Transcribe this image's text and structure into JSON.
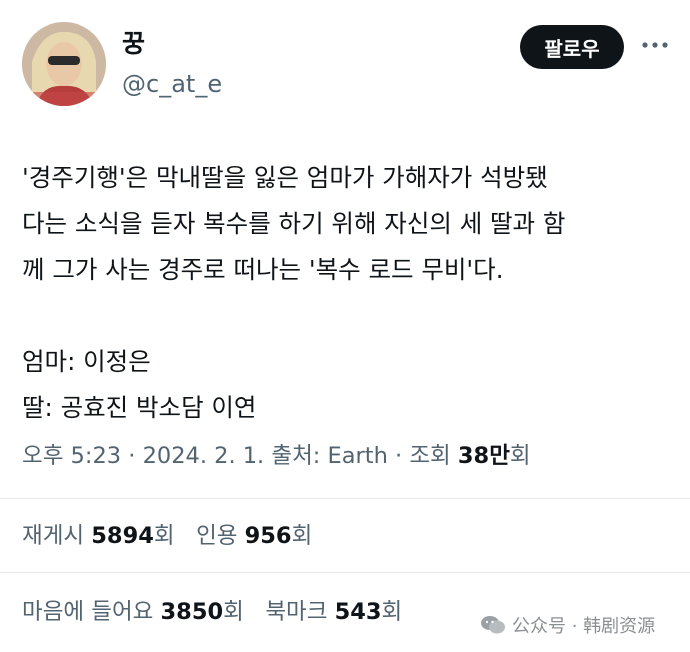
{
  "user": {
    "name": "꿍",
    "handle": "@c_at_e"
  },
  "follow_label": "팔로우",
  "tweet_text": "'경주기행'은 막내딸을 잃은 엄마가 가해자가 석방됐\n다는 소식을 듣자 복수를 하기 위해 자신의 세 딸과 함\n께 그가 사는 경주로 떠나는 '복수 로드 무비'다.\n\n엄마: 이정은\n딸: 공효진 박소담 이연",
  "meta": {
    "time": "오후 5:23",
    "date": "2024. 2. 1.",
    "source": "출처: Earth",
    "views_label": "조회",
    "views_count": "38만",
    "views_suffix": "회"
  },
  "stats": {
    "retweets_label": "재게시",
    "retweets_count": "5894",
    "retweets_suffix": "회",
    "quotes_label": "인용",
    "quotes_count": "956",
    "quotes_suffix": "회",
    "likes_label": "마음에 들어요",
    "likes_count": "3850",
    "likes_suffix": "회",
    "bookmarks_label": "북마크",
    "bookmarks_count": "543",
    "bookmarks_suffix": "회"
  },
  "watermark": "公众号 · 韩剧资源"
}
